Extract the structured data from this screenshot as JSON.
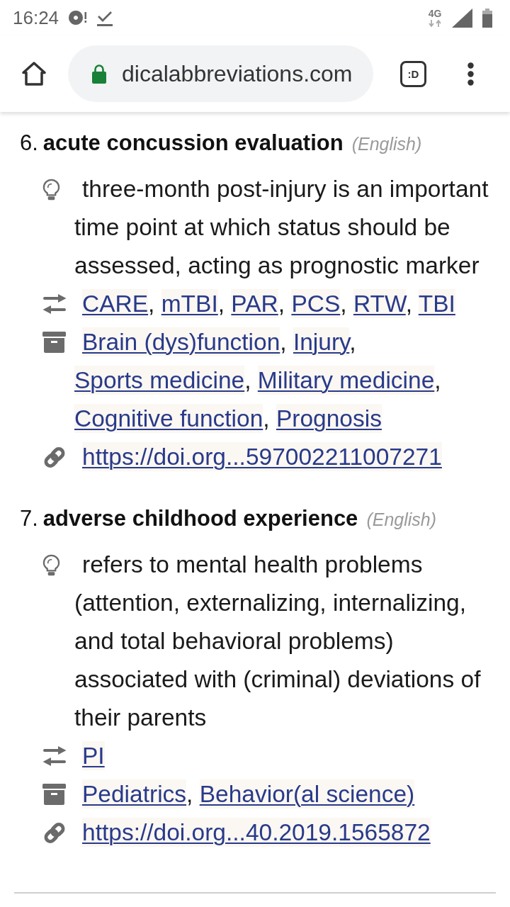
{
  "status_bar": {
    "time": "16:24",
    "network_type": "4G"
  },
  "browser_toolbar": {
    "url": "dicalabbreviations.com",
    "tab_count": ":D"
  },
  "separator": ",",
  "entries": [
    {
      "number": "6.",
      "term": "acute concussion evaluation",
      "language": "(English)",
      "definition": "three-month post-injury is an important time point at which status should be assessed, acting as prognostic marker",
      "abbreviations": [
        "CARE",
        "mTBI",
        "PAR",
        "PCS",
        "RTW",
        "TBI"
      ],
      "categories": [
        "Brain (dys)function",
        "Injury",
        "Sports medicine",
        "Military medicine",
        "Cognitive function",
        "Prognosis"
      ],
      "link": "https://doi.org...597002211007271"
    },
    {
      "number": "7.",
      "term": "adverse childhood experience",
      "language": "(English)",
      "definition": "refers to mental health problems (attention, externalizing, internalizing, and total behavioral problems) associated with (criminal) deviations of their parents",
      "abbreviations": [
        "PI"
      ],
      "categories": [
        "Pediatrics",
        "Behavior(al science)"
      ],
      "link": "https://doi.org...40.2019.1565872"
    }
  ]
}
